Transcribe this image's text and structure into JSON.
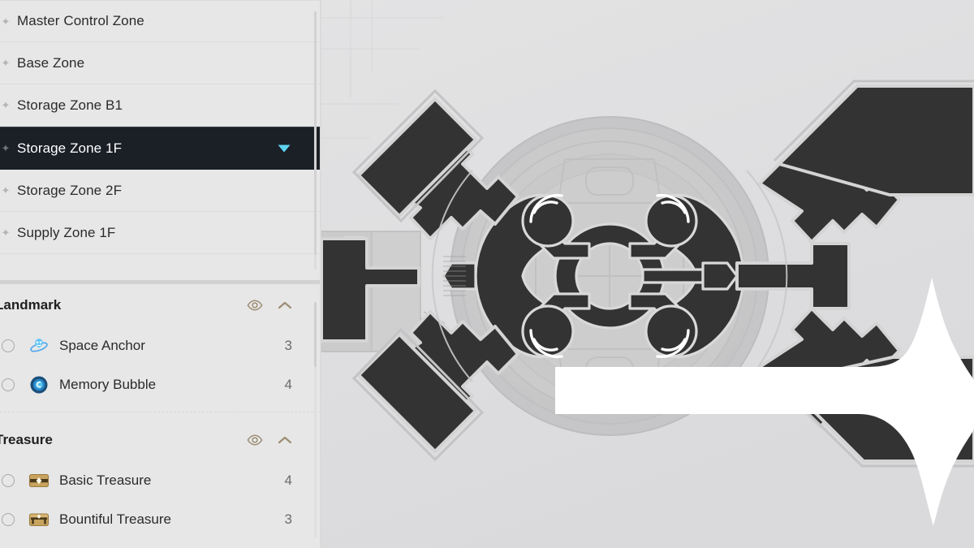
{
  "sidebar": {
    "zone_list": {
      "name": "zone-list",
      "bullet_glyph": "✦",
      "selected_index": 3,
      "selected_chevron_icon": "chevron-down-icon",
      "selected_chevron_color": "#5fd8f5",
      "items": [
        {
          "label": "Master Control Zone"
        },
        {
          "label": "Base Zone"
        },
        {
          "label": "Storage Zone B1"
        },
        {
          "label": "Storage Zone 1F"
        },
        {
          "label": "Storage Zone 2F"
        },
        {
          "label": "Supply Zone 1F"
        }
      ]
    },
    "filter_panel": {
      "sections": [
        {
          "title": "Landmark",
          "eye_icon": "eye-icon",
          "collapse_icon": "chevron-up-icon",
          "items": [
            {
              "label": "Space Anchor",
              "count": "3",
              "icon": "space-anchor-icon"
            },
            {
              "label": "Memory Bubble",
              "count": "4",
              "icon": "memory-bubble-icon"
            }
          ]
        },
        {
          "title": "Treasure",
          "eye_icon": "eye-icon",
          "collapse_icon": "chevron-up-icon",
          "items": [
            {
              "label": "Basic Treasure",
              "count": "4",
              "icon": "basic-treasure-chest-icon"
            },
            {
              "label": "Bountiful Treasure",
              "count": "3",
              "icon": "bountiful-treasure-chest-icon"
            }
          ]
        }
      ]
    }
  },
  "map": {
    "name": "floor-plan-map",
    "description": "Grayscale architectural floor plan with a large central circular hub and angled wings",
    "background_color": "#dfdfe0",
    "room_fill_color": "#333333",
    "room_outline_color": "#cccccc",
    "hub_fill_color": "#c9c9ca"
  },
  "annotation": {
    "name": "arrow-annotation",
    "type": "arrow",
    "direction": "right",
    "color": "#ffffff"
  }
}
